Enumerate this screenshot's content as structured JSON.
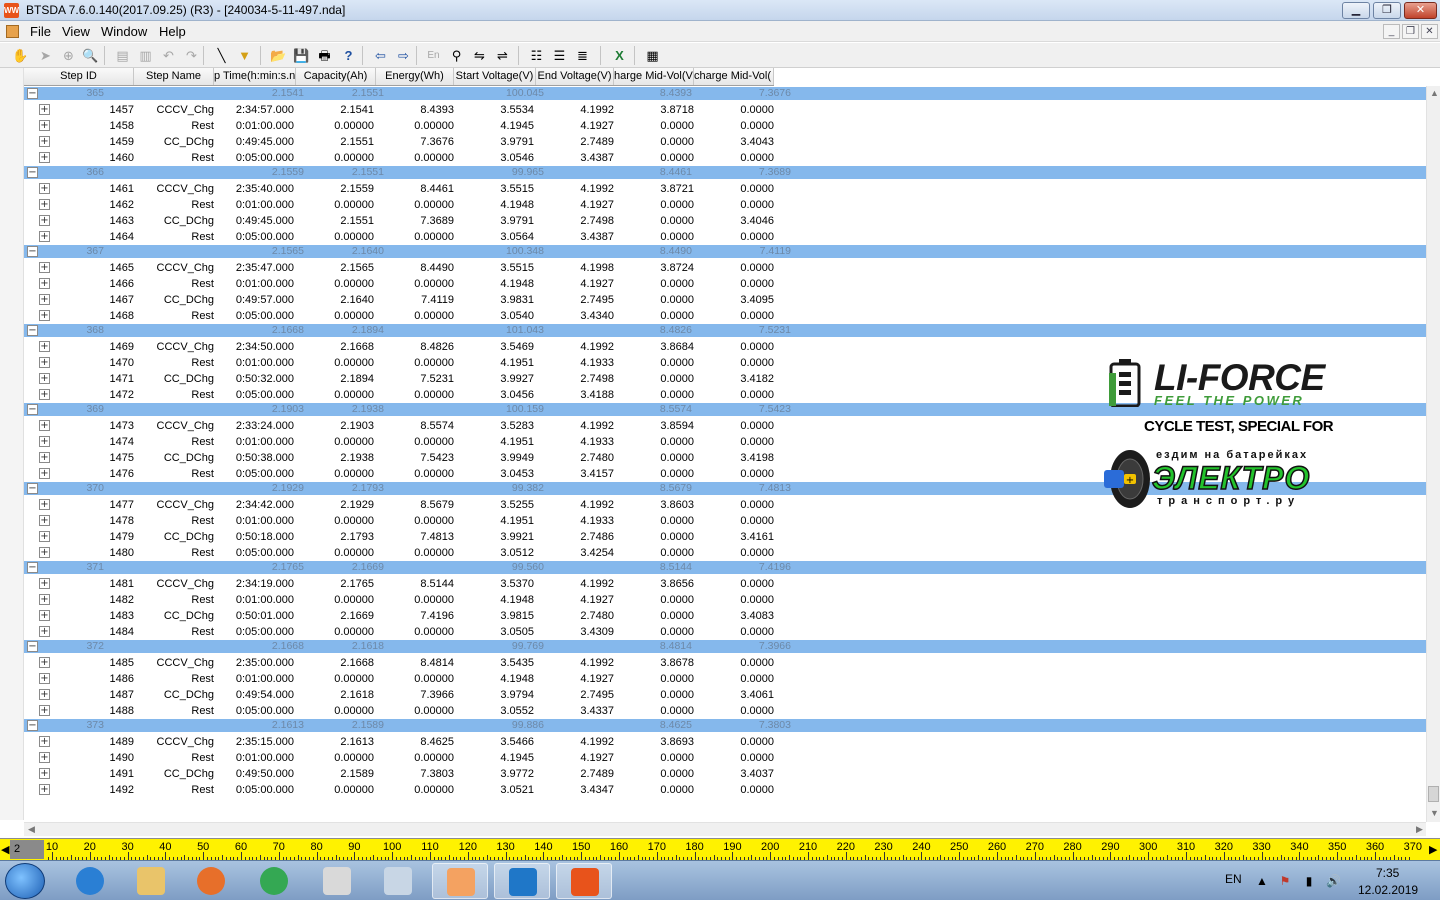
{
  "window": {
    "title": "BTSDA 7.6.0.140(2017.09.25) (R3) - [240034-5-11-497.nda]",
    "icon_label": "WW",
    "min_glyph": "▁",
    "max_glyph": "❐",
    "close_glyph": "✕"
  },
  "menu": {
    "items": [
      "File",
      "View",
      "Window",
      "Help"
    ],
    "mdi_min": "_",
    "mdi_restore": "❐",
    "mdi_close": "✕"
  },
  "toolbar": {
    "icons": [
      {
        "name": "hand-icon",
        "glyph": "✋",
        "enabled": false
      },
      {
        "name": "pointer-icon",
        "glyph": "➤",
        "enabled": false
      },
      {
        "name": "zoom-area-icon",
        "glyph": "⊕",
        "enabled": false
      },
      {
        "name": "zoom-icon",
        "glyph": "🔍",
        "enabled": false
      },
      {
        "name": "table-icon",
        "glyph": "▤",
        "enabled": false
      },
      {
        "name": "copy-table-icon",
        "glyph": "▥",
        "enabled": false
      },
      {
        "name": "undo-icon",
        "glyph": "↶",
        "enabled": false
      },
      {
        "name": "redo-icon",
        "glyph": "↷",
        "enabled": false
      },
      {
        "name": "line-tool-icon",
        "glyph": "╲",
        "enabled": true
      },
      {
        "name": "filter-icon",
        "glyph": "▼",
        "enabled": true
      },
      {
        "name": "open-folder-icon",
        "glyph": "📂",
        "enabled": true
      },
      {
        "name": "save-icon",
        "glyph": "💾",
        "enabled": true
      },
      {
        "name": "print-icon",
        "glyph": "🖶",
        "enabled": true
      },
      {
        "name": "help-icon",
        "glyph": "?",
        "enabled": true
      },
      {
        "name": "back-icon",
        "glyph": "⇦",
        "enabled": true
      },
      {
        "name": "forward-icon",
        "glyph": "⇨",
        "enabled": true
      },
      {
        "name": "language-icon",
        "glyph": "En",
        "enabled": false
      },
      {
        "name": "marker-icon",
        "glyph": "⚲",
        "enabled": true
      },
      {
        "name": "align-left-icon",
        "glyph": "⇋",
        "enabled": true
      },
      {
        "name": "align-right-icon",
        "glyph": "⇌",
        "enabled": true
      },
      {
        "name": "grid-view-icon",
        "glyph": "☷",
        "enabled": true
      },
      {
        "name": "detail-view-icon",
        "glyph": "☰",
        "enabled": true
      },
      {
        "name": "list-view-icon",
        "glyph": "≣",
        "enabled": true
      },
      {
        "name": "excel-export-icon",
        "glyph": "X",
        "enabled": true
      },
      {
        "name": "layout-icon",
        "glyph": "▦",
        "enabled": true
      }
    ]
  },
  "grid": {
    "columns": [
      "Step ID",
      "Step Name",
      "p Time(h:min:s.n",
      "Capacity(Ah)",
      "Energy(Wh)",
      "Start Voltage(V)",
      "End Voltage(V)",
      "harge Mid-Vol(V",
      "charge Mid-Vol("
    ],
    "expand_glyph": "+",
    "collapse_glyph": "−",
    "cycles": [
      {
        "cycle": "365",
        "chg_cap": "2.1541",
        "dchg_cap": "2.1551",
        "efficiency": "100.045",
        "chg_energy": "8.4393",
        "dchg_energy": "7.3676",
        "steps": [
          [
            "1457",
            "CCCV_Chg",
            "2:34:57.000",
            "2.1541",
            "8.4393",
            "3.5534",
            "4.1992",
            "3.8718",
            "0.0000"
          ],
          [
            "1458",
            "Rest",
            "0:01:00.000",
            "0.00000",
            "0.00000",
            "4.1945",
            "4.1927",
            "0.0000",
            "0.0000"
          ],
          [
            "1459",
            "CC_DChg",
            "0:49:45.000",
            "2.1551",
            "7.3676",
            "3.9791",
            "2.7489",
            "0.0000",
            "3.4043"
          ],
          [
            "1460",
            "Rest",
            "0:05:00.000",
            "0.00000",
            "0.00000",
            "3.0546",
            "3.4387",
            "0.0000",
            "0.0000"
          ]
        ]
      },
      {
        "cycle": "366",
        "chg_cap": "2.1559",
        "dchg_cap": "2.1551",
        "efficiency": "99.965",
        "chg_energy": "8.4461",
        "dchg_energy": "7.3689",
        "steps": [
          [
            "1461",
            "CCCV_Chg",
            "2:35:40.000",
            "2.1559",
            "8.4461",
            "3.5515",
            "4.1992",
            "3.8721",
            "0.0000"
          ],
          [
            "1462",
            "Rest",
            "0:01:00.000",
            "0.00000",
            "0.00000",
            "4.1948",
            "4.1927",
            "0.0000",
            "0.0000"
          ],
          [
            "1463",
            "CC_DChg",
            "0:49:45.000",
            "2.1551",
            "7.3689",
            "3.9791",
            "2.7498",
            "0.0000",
            "3.4046"
          ],
          [
            "1464",
            "Rest",
            "0:05:00.000",
            "0.00000",
            "0.00000",
            "3.0564",
            "3.4387",
            "0.0000",
            "0.0000"
          ]
        ]
      },
      {
        "cycle": "367",
        "chg_cap": "2.1565",
        "dchg_cap": "2.1640",
        "efficiency": "100.348",
        "chg_energy": "8.4490",
        "dchg_energy": "7.4119",
        "steps": [
          [
            "1465",
            "CCCV_Chg",
            "2:35:47.000",
            "2.1565",
            "8.4490",
            "3.5515",
            "4.1998",
            "3.8724",
            "0.0000"
          ],
          [
            "1466",
            "Rest",
            "0:01:00.000",
            "0.00000",
            "0.00000",
            "4.1948",
            "4.1927",
            "0.0000",
            "0.0000"
          ],
          [
            "1467",
            "CC_DChg",
            "0:49:57.000",
            "2.1640",
            "7.4119",
            "3.9831",
            "2.7495",
            "0.0000",
            "3.4095"
          ],
          [
            "1468",
            "Rest",
            "0:05:00.000",
            "0.00000",
            "0.00000",
            "3.0540",
            "3.4340",
            "0.0000",
            "0.0000"
          ]
        ]
      },
      {
        "cycle": "368",
        "chg_cap": "2.1668",
        "dchg_cap": "2.1894",
        "efficiency": "101.043",
        "chg_energy": "8.4826",
        "dchg_energy": "7.5231",
        "steps": [
          [
            "1469",
            "CCCV_Chg",
            "2:34:50.000",
            "2.1668",
            "8.4826",
            "3.5469",
            "4.1992",
            "3.8684",
            "0.0000"
          ],
          [
            "1470",
            "Rest",
            "0:01:00.000",
            "0.00000",
            "0.00000",
            "4.1951",
            "4.1933",
            "0.0000",
            "0.0000"
          ],
          [
            "1471",
            "CC_DChg",
            "0:50:32.000",
            "2.1894",
            "7.5231",
            "3.9927",
            "2.7498",
            "0.0000",
            "3.4182"
          ],
          [
            "1472",
            "Rest",
            "0:05:00.000",
            "0.00000",
            "0.00000",
            "3.0456",
            "3.4188",
            "0.0000",
            "0.0000"
          ]
        ]
      },
      {
        "cycle": "369",
        "chg_cap": "2.1903",
        "dchg_cap": "2.1938",
        "efficiency": "100.159",
        "chg_energy": "8.5574",
        "dchg_energy": "7.5423",
        "steps": [
          [
            "1473",
            "CCCV_Chg",
            "2:33:24.000",
            "2.1903",
            "8.5574",
            "3.5283",
            "4.1992",
            "3.8594",
            "0.0000"
          ],
          [
            "1474",
            "Rest",
            "0:01:00.000",
            "0.00000",
            "0.00000",
            "4.1951",
            "4.1933",
            "0.0000",
            "0.0000"
          ],
          [
            "1475",
            "CC_DChg",
            "0:50:38.000",
            "2.1938",
            "7.5423",
            "3.9949",
            "2.7480",
            "0.0000",
            "3.4198"
          ],
          [
            "1476",
            "Rest",
            "0:05:00.000",
            "0.00000",
            "0.00000",
            "3.0453",
            "3.4157",
            "0.0000",
            "0.0000"
          ]
        ]
      },
      {
        "cycle": "370",
        "chg_cap": "2.1929",
        "dchg_cap": "2.1793",
        "efficiency": "99.382",
        "chg_energy": "8.5679",
        "dchg_energy": "7.4813",
        "steps": [
          [
            "1477",
            "CCCV_Chg",
            "2:34:42.000",
            "2.1929",
            "8.5679",
            "3.5255",
            "4.1992",
            "3.8603",
            "0.0000"
          ],
          [
            "1478",
            "Rest",
            "0:01:00.000",
            "0.00000",
            "0.00000",
            "4.1951",
            "4.1933",
            "0.0000",
            "0.0000"
          ],
          [
            "1479",
            "CC_DChg",
            "0:50:18.000",
            "2.1793",
            "7.4813",
            "3.9921",
            "2.7486",
            "0.0000",
            "3.4161"
          ],
          [
            "1480",
            "Rest",
            "0:05:00.000",
            "0.00000",
            "0.00000",
            "3.0512",
            "3.4254",
            "0.0000",
            "0.0000"
          ]
        ]
      },
      {
        "cycle": "371",
        "chg_cap": "2.1765",
        "dchg_cap": "2.1669",
        "efficiency": "99.560",
        "chg_energy": "8.5144",
        "dchg_energy": "7.4196",
        "steps": [
          [
            "1481",
            "CCCV_Chg",
            "2:34:19.000",
            "2.1765",
            "8.5144",
            "3.5370",
            "4.1992",
            "3.8656",
            "0.0000"
          ],
          [
            "1482",
            "Rest",
            "0:01:00.000",
            "0.00000",
            "0.00000",
            "4.1948",
            "4.1927",
            "0.0000",
            "0.0000"
          ],
          [
            "1483",
            "CC_DChg",
            "0:50:01.000",
            "2.1669",
            "7.4196",
            "3.9815",
            "2.7480",
            "0.0000",
            "3.4083"
          ],
          [
            "1484",
            "Rest",
            "0:05:00.000",
            "0.00000",
            "0.00000",
            "3.0505",
            "3.4309",
            "0.0000",
            "0.0000"
          ]
        ]
      },
      {
        "cycle": "372",
        "chg_cap": "2.1668",
        "dchg_cap": "2.1618",
        "efficiency": "99.769",
        "chg_energy": "8.4814",
        "dchg_energy": "7.3966",
        "steps": [
          [
            "1485",
            "CCCV_Chg",
            "2:35:00.000",
            "2.1668",
            "8.4814",
            "3.5435",
            "4.1992",
            "3.8678",
            "0.0000"
          ],
          [
            "1486",
            "Rest",
            "0:01:00.000",
            "0.00000",
            "0.00000",
            "4.1948",
            "4.1927",
            "0.0000",
            "0.0000"
          ],
          [
            "1487",
            "CC_DChg",
            "0:49:54.000",
            "2.1618",
            "7.3966",
            "3.9794",
            "2.7495",
            "0.0000",
            "3.4061"
          ],
          [
            "1488",
            "Rest",
            "0:05:00.000",
            "0.00000",
            "0.00000",
            "3.0552",
            "3.4337",
            "0.0000",
            "0.0000"
          ]
        ]
      },
      {
        "cycle": "373",
        "chg_cap": "2.1613",
        "dchg_cap": "2.1589",
        "efficiency": "99.886",
        "chg_energy": "8.4625",
        "dchg_energy": "7.3803",
        "steps": [
          [
            "1489",
            "CCCV_Chg",
            "2:35:15.000",
            "2.1613",
            "8.4625",
            "3.5466",
            "4.1992",
            "3.8693",
            "0.0000"
          ],
          [
            "1490",
            "Rest",
            "0:01:00.000",
            "0.00000",
            "0.00000",
            "4.1945",
            "4.1927",
            "0.0000",
            "0.0000"
          ],
          [
            "1491",
            "CC_DChg",
            "0:49:50.000",
            "2.1589",
            "7.3803",
            "3.9772",
            "2.7489",
            "0.0000",
            "3.4037"
          ],
          [
            "1492",
            "Rest",
            "0:05:00.000",
            "0.00000",
            "0.00000",
            "3.0521",
            "3.4347",
            "0.0000",
            "0.0000"
          ]
        ]
      }
    ]
  },
  "scroll": {
    "left_arrow": "◀",
    "right_arrow": "▶",
    "up_arrow": "▲",
    "down_arrow": "▼"
  },
  "ruler": {
    "current": "2",
    "labels": [
      "10",
      "20",
      "30",
      "40",
      "50",
      "60",
      "70",
      "80",
      "90",
      "100",
      "110",
      "120",
      "130",
      "140",
      "150",
      "160",
      "170",
      "180",
      "190",
      "200",
      "210",
      "220",
      "230",
      "240",
      "250",
      "260",
      "270",
      "280",
      "290",
      "300",
      "310",
      "320",
      "330",
      "340",
      "350",
      "360",
      "370"
    ],
    "left_arrow": "◀",
    "right_arrow": "▶"
  },
  "watermark": {
    "brand": "LI-FORCE",
    "tagline": "FEEL THE POWER",
    "cycle_text": "CYCLE TEST, SPECIAL FOR",
    "el_top": "ездим на батарейках",
    "el_big": "ЭЛЕКТРО",
    "el_bottom": "транспорт.ру"
  },
  "taskbar": {
    "apps": [
      {
        "name": "internet-explorer",
        "color": "#2a7fd4",
        "active": false
      },
      {
        "name": "file-explorer",
        "color": "#e9c46a",
        "active": false
      },
      {
        "name": "media-player",
        "color": "#e76f2a",
        "active": false
      },
      {
        "name": "chrome",
        "color": "#34a853",
        "active": false
      },
      {
        "name": "virtualbox",
        "color": "#d9d9d9",
        "active": false
      },
      {
        "name": "calculator",
        "color": "#c8d6e5",
        "active": false
      },
      {
        "name": "paint",
        "color": "#f4a261",
        "active": true
      },
      {
        "name": "btsda-monitor",
        "color": "#1f77c8",
        "active": true
      },
      {
        "name": "btsda-data",
        "color": "#e8531b",
        "active": true
      }
    ],
    "language": "EN",
    "tray_up": "▲",
    "tray_flag": "⚑",
    "tray_network": "▮",
    "tray_volume": "🔊",
    "time": "7:35",
    "date": "12.02.2019"
  }
}
